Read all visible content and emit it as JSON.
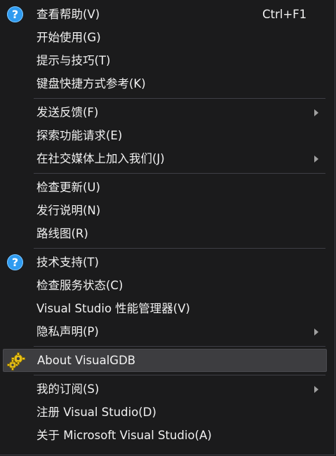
{
  "menu": {
    "items": [
      {
        "label": "查看帮助(V)",
        "shortcut": "Ctrl+F1",
        "icon": "help-icon"
      },
      {
        "label": "开始使用(G)"
      },
      {
        "label": "提示与技巧(T)"
      },
      {
        "label": "键盘快捷方式参考(K)"
      },
      {
        "label": "发送反馈(F)",
        "submenu": true
      },
      {
        "label": "探索功能请求(E)"
      },
      {
        "label": "在社交媒体上加入我们(J)",
        "submenu": true
      },
      {
        "label": "检查更新(U)"
      },
      {
        "label": "发行说明(N)"
      },
      {
        "label": "路线图(R)"
      },
      {
        "label": "技术支持(T)",
        "icon": "help-icon"
      },
      {
        "label": "检查服务状态(C)"
      },
      {
        "label": "Visual Studio 性能管理器(V)"
      },
      {
        "label": "隐私声明(P)",
        "submenu": true
      },
      {
        "label": "About VisualGDB",
        "icon": "visualgdb-gear-icon",
        "highlighted": true
      },
      {
        "label": "我的订阅(S)",
        "submenu": true
      },
      {
        "label": "注册 Visual Studio(D)"
      },
      {
        "label": "关于 Microsoft Visual Studio(A)"
      }
    ]
  },
  "colors": {
    "background": "#1b1b1c",
    "text": "#f1f1f1",
    "separator": "#3f3f46",
    "highlight": "#3d3d40",
    "help_icon": "#2f9bf0"
  }
}
